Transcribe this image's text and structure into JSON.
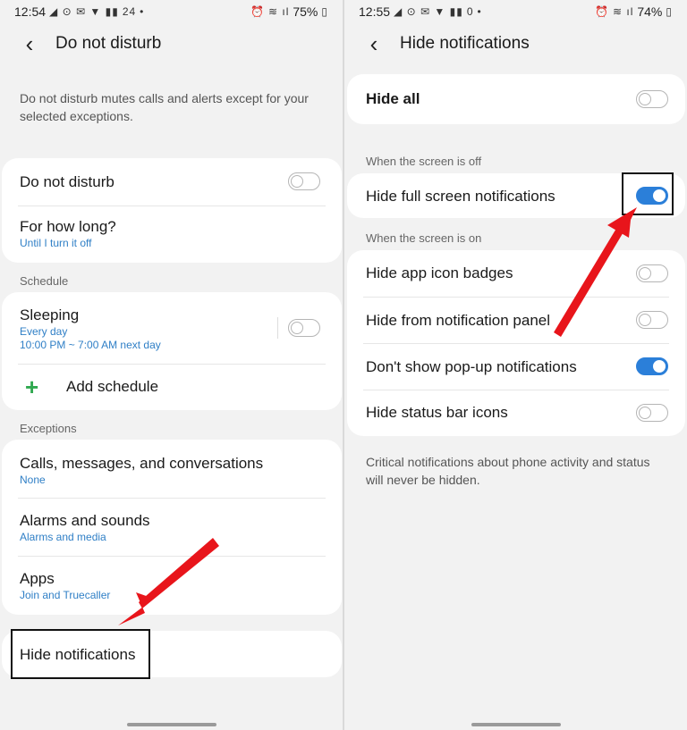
{
  "left": {
    "status": {
      "time": "12:54",
      "notif_icons": "◢ ⊙ ✉ ▼ ▮▮",
      "speed": "24",
      "battery": "75%"
    },
    "title": "Do not disturb",
    "description": "Do not disturb mutes calls and alerts except for your selected exceptions.",
    "main_card": {
      "dnd_label": "Do not disturb",
      "dnd_on": false,
      "duration_label": "For how long?",
      "duration_value": "Until I turn it off"
    },
    "schedule": {
      "header": "Schedule",
      "sleeping_label": "Sleeping",
      "sleeping_days": "Every day",
      "sleeping_time": "10:00 PM ~ 7:00 AM next day",
      "sleeping_on": false,
      "add_label": "Add schedule"
    },
    "exceptions": {
      "header": "Exceptions",
      "items": [
        {
          "label": "Calls, messages, and conversations",
          "sub": "None"
        },
        {
          "label": "Alarms and sounds",
          "sub": "Alarms and media"
        },
        {
          "label": "Apps",
          "sub": "Join and Truecaller"
        }
      ]
    },
    "hide_notifications": "Hide notifications"
  },
  "right": {
    "status": {
      "time": "12:55",
      "notif_icons": "◢ ⊙ ✉ ▼ ▮▮",
      "speed": "0",
      "battery": "74%"
    },
    "title": "Hide notifications",
    "hide_all": {
      "label": "Hide all",
      "on": false
    },
    "screen_off": {
      "header": "When the screen is off",
      "items": [
        {
          "label": "Hide full screen notifications",
          "on": true
        }
      ]
    },
    "screen_on": {
      "header": "When the screen is on",
      "items": [
        {
          "label": "Hide app icon badges",
          "on": false
        },
        {
          "label": "Hide from notification panel",
          "on": false
        },
        {
          "label": "Don't show pop-up notifications",
          "on": true
        },
        {
          "label": "Hide status bar icons",
          "on": false
        }
      ]
    },
    "footer": "Critical notifications about phone activity and status will never be hidden."
  },
  "colors": {
    "accent": "#2b7fd9",
    "link": "#2f7fc6",
    "arrow": "#e8151b",
    "add": "#2fa84f"
  }
}
